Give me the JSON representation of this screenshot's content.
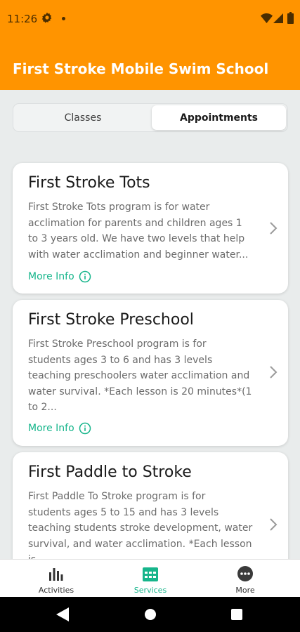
{
  "status_bar": {
    "time": "11:26",
    "icons": [
      "gear-icon",
      "dot-icon",
      "wifi-icon",
      "signal-icon",
      "battery-icon"
    ]
  },
  "header": {
    "title": "First Stroke Mobile Swim School",
    "color": "#ff9400"
  },
  "segmented": {
    "tabs": [
      {
        "label": "Classes",
        "selected": false
      },
      {
        "label": "Appointments",
        "selected": true
      }
    ]
  },
  "cards": [
    {
      "title": "First Stroke Tots",
      "desc_lines": [
        "First Stroke Tots program is for water",
        "acclimation for parents and children ages 1",
        "to 3 years old.  We have two levels that help",
        "with water acclimation and beginner water..."
      ],
      "more_info": "More Info"
    },
    {
      "title": "First Stroke Preschool",
      "desc_lines": [
        "First Stroke Preschool program is for",
        "students ages 3 to 6 and has 3 levels",
        "teaching preschoolers water acclimation and",
        "water survival. *Each lesson is 20 minutes*(1",
        "to 2..."
      ],
      "more_info": "More Info"
    },
    {
      "title": "First Paddle to Stroke",
      "desc_lines": [
        "First Paddle To Stroke program is for",
        "students ages 5 to 15 and has 3 levels",
        "teaching students stroke development, water",
        "survival, and water acclimation. *Each lesson",
        "is..."
      ]
    }
  ],
  "bottom_nav": {
    "items": [
      {
        "label": "Activities",
        "icon": "bar-chart-icon",
        "active": false
      },
      {
        "label": "Services",
        "icon": "calendar-icon",
        "active": true
      },
      {
        "label": "More",
        "icon": "more-dots-icon",
        "active": false
      }
    ],
    "accent": "#16b58b"
  },
  "system_nav": {
    "icons": [
      "back-icon",
      "home-icon",
      "recents-icon"
    ]
  }
}
